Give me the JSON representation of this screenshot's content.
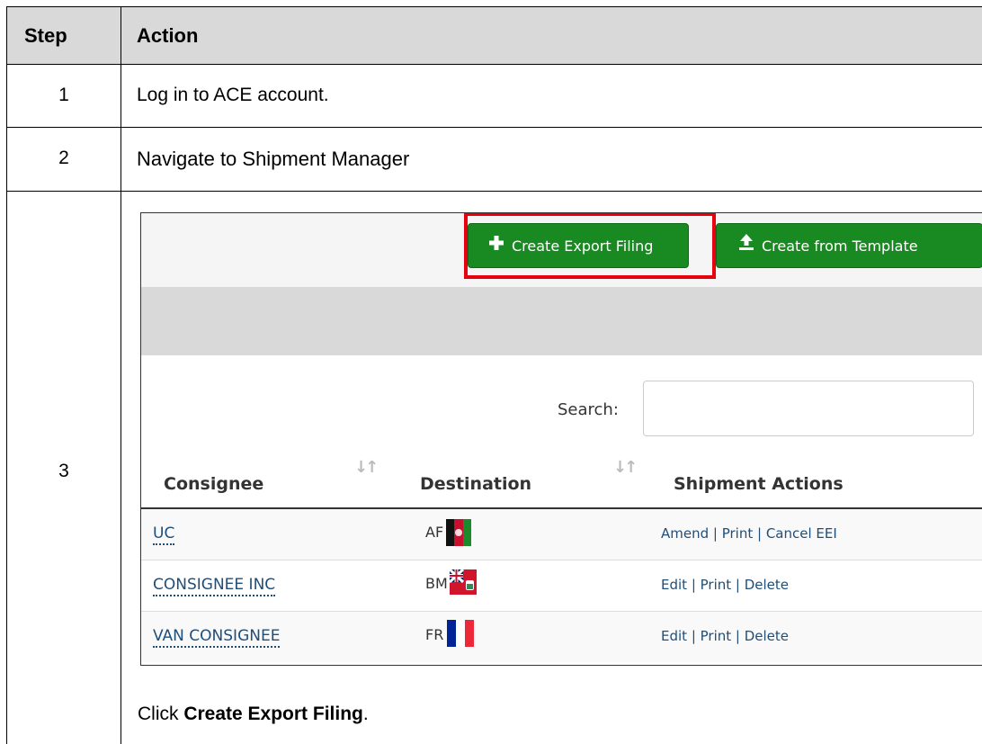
{
  "table": {
    "header": {
      "step": "Step",
      "action": "Action"
    },
    "rows": [
      {
        "step": "1",
        "action": "Log in to ACE account."
      },
      {
        "step": "2",
        "action": "Navigate to Shipment Manager"
      },
      {
        "step": "3",
        "caption_prefix": "Click ",
        "caption_bold": "Create Export Filing",
        "caption_suffix": "."
      }
    ]
  },
  "app": {
    "buttons": {
      "create_export": {
        "icon": "plus-icon",
        "label": "Create Export Filing"
      },
      "create_template": {
        "icon": "upload-icon",
        "label": "Create from Template"
      }
    },
    "search": {
      "label": "Search:",
      "placeholder": "",
      "value": ""
    },
    "columns": [
      "Consignee",
      "Destination",
      "Shipment Actions"
    ],
    "shipments": [
      {
        "consignee": "UC",
        "destination": "AF",
        "flag": "afghanistan-flag-icon",
        "actions": "Amend | Print | Cancel EEI"
      },
      {
        "consignee": "CONSIGNEE INC",
        "destination": "BM",
        "flag": "bermuda-flag-icon",
        "actions": "Edit | Print | Delete"
      },
      {
        "consignee": "VAN CONSIGNEE",
        "destination": "FR",
        "flag": "france-flag-icon",
        "actions": "Edit | Print | Delete"
      }
    ],
    "colors": {
      "button_green": "#198a21",
      "highlight_red": "#e8000f",
      "link_blue": "#1f4e79"
    }
  }
}
